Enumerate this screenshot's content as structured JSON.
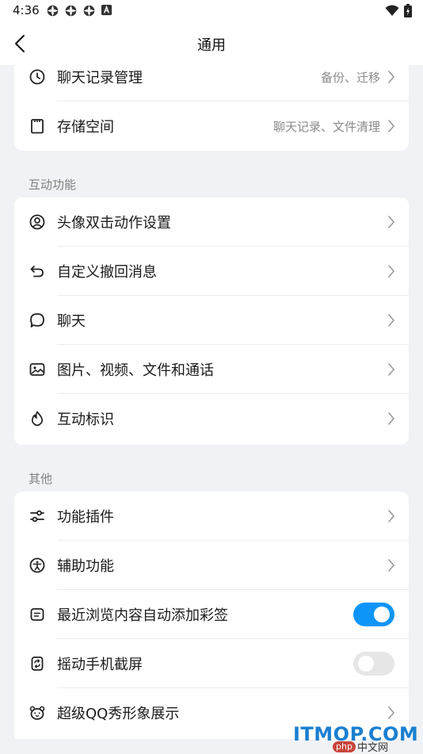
{
  "status": {
    "time": "4:36"
  },
  "header": {
    "title": "通用"
  },
  "card1": {
    "items": [
      {
        "label": "聊天记录管理",
        "sub": "备份、迁移"
      },
      {
        "label": "存储空间",
        "sub": "聊天记录、文件清理"
      }
    ]
  },
  "section_interactive": {
    "title": "互动功能",
    "items": [
      {
        "label": "头像双击动作设置"
      },
      {
        "label": "自定义撤回消息"
      },
      {
        "label": "聊天"
      },
      {
        "label": "图片、视频、文件和通话"
      },
      {
        "label": "互动标识"
      }
    ]
  },
  "section_other": {
    "title": "其他",
    "items": [
      {
        "label": "功能插件"
      },
      {
        "label": "辅助功能"
      },
      {
        "label": "最近浏览内容自动添加彩签",
        "toggle": "on"
      },
      {
        "label": "摇动手机截屏",
        "toggle": "off"
      },
      {
        "label": "超级QQ秀形象展示"
      }
    ]
  },
  "watermark": {
    "text": "ITMOP.COM",
    "badge": "php",
    "site": "中文网"
  },
  "colors": {
    "accent": "#0f95f7",
    "background": "#f1f2f5",
    "card": "#ffffff"
  }
}
